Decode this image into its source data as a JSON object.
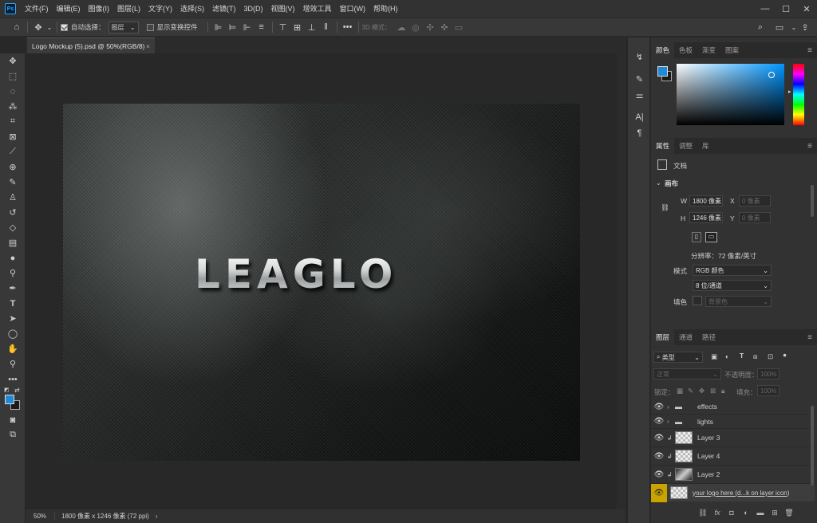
{
  "menubar": {
    "app_badge": "Ps",
    "items": [
      "文件(F)",
      "编辑(E)",
      "图像(I)",
      "图层(L)",
      "文字(Y)",
      "选择(S)",
      "滤镜(T)",
      "3D(D)",
      "视图(V)",
      "增效工具",
      "窗口(W)",
      "帮助(H)"
    ],
    "minimize": "—",
    "maximize": "☐",
    "close": "✕"
  },
  "options": {
    "auto_select_label": "自动选择：",
    "auto_select_value": "图层",
    "show_transform_label": "显示变换控件",
    "mode_3d_label": "3D 模式："
  },
  "document": {
    "tab_title": "Logo Mockup (5).psd @ 50%(RGB/8)",
    "tab_close": "×",
    "logo_text": "LEAGLO"
  },
  "statusbar": {
    "zoom": "50%",
    "doc_info": "1800 像素 x 1246 像素 (72 ppi)",
    "arrow": "›"
  },
  "colors": {
    "accent": "#1f7fc4",
    "foreground": "#1f8ad6",
    "background": "#1a1a1a",
    "selected_layer_eye": "#c9a400"
  },
  "color_panel": {
    "tabs": [
      "颜色",
      "色板",
      "渐变",
      "图案"
    ]
  },
  "properties_panel": {
    "tabs": [
      "属性",
      "调整",
      "库"
    ],
    "doc_label": "文档",
    "canvas_section": "画布",
    "w_label": "W",
    "w_value": "1800 像素",
    "h_label": "H",
    "h_value": "1246 像素",
    "x_label": "X",
    "x_value": "0 像素",
    "y_label": "Y",
    "y_value": "0 像素",
    "resolution": "分辨率：72 像素/英寸",
    "mode_label": "模式",
    "mode_value": "RGB 颜色",
    "depth_value": "8 位/通道",
    "fill_label": "填色",
    "fill_value": "背景色"
  },
  "layers_panel": {
    "tabs": [
      "图层",
      "通道",
      "路径"
    ],
    "filter_value": "类型",
    "blend_value": "正常",
    "opacity_label": "不透明度：",
    "opacity_value": "100%",
    "lock_label": "锁定：",
    "fill_label": "填充：",
    "fill_value": "100%",
    "layers": [
      {
        "name": "effects",
        "type": "group"
      },
      {
        "name": "lights",
        "type": "group"
      },
      {
        "name": "Layer 3",
        "type": "layer"
      },
      {
        "name": "Layer 4",
        "type": "layer"
      },
      {
        "name": "Layer 2",
        "type": "layer"
      },
      {
        "name": "your logo here (d...k on layer icon)",
        "type": "smart"
      }
    ]
  }
}
